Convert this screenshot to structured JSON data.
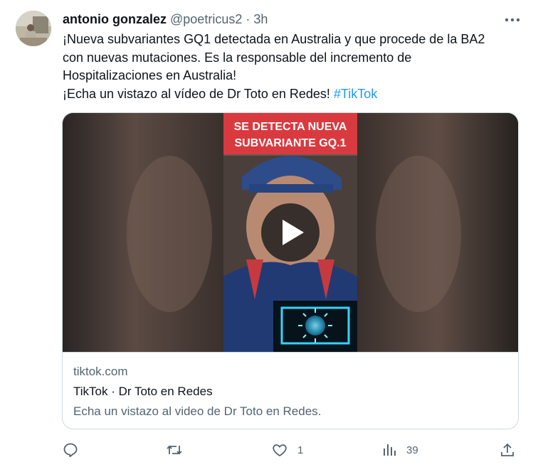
{
  "tweet": {
    "author": {
      "display_name": "antonio gonzalez",
      "handle": "@poetricus2",
      "separator": "·",
      "time": "3h"
    },
    "text_lines": [
      "¡Nueva subvariantes GQ1 detectada en Australia y que procede de la BA2",
      "con nuevas mutaciones. Es la responsable del incremento de",
      "Hospitalizaciones en Australia!"
    ],
    "text_last_prefix": "¡Echa un vistazo al vídeo de Dr Toto en Redes! ",
    "hashtag": "#TikTok",
    "card": {
      "video_caption_line1": "SE DETECTA NUEVA",
      "video_caption_line2": "SUBVARIANTE GQ.1",
      "domain": "tiktok.com",
      "title": "TikTok · Dr Toto en Redes",
      "description": "Echa un vistazo al video de Dr Toto en Redes."
    },
    "actions": {
      "reply_count": "",
      "retweet_count": "",
      "like_count": "1",
      "views_count": "39"
    },
    "colors": {
      "text": "#0f1419",
      "secondary": "#536471",
      "link": "#1d9bf0",
      "border": "#cfd9de",
      "caption_bg": "#d93a3f"
    },
    "icons": [
      "more-icon",
      "play-icon",
      "reply-icon",
      "retweet-icon",
      "like-icon",
      "views-icon",
      "share-icon"
    ]
  }
}
